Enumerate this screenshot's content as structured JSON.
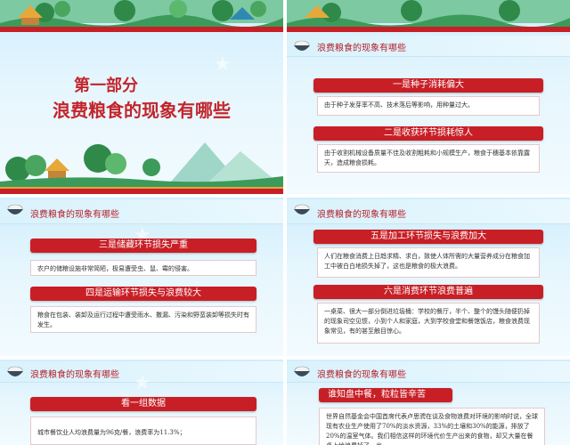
{
  "cover": {
    "part": "第一部分",
    "title": "浪费粮食的现象有哪些"
  },
  "header_title": "浪费粮食的现象有哪些",
  "slide2": {
    "bar1": "一是种子消耗偏大",
    "card1": "由于种子发芽率不高、技术落后等影响，用种量过大。",
    "bar2": "二是收获环节损耗惊人",
    "card2": "由于收割机械设备质量不佳及收割粗耗和小规模生产，粮食于穗基本依靠露天，造成粮食损耗。"
  },
  "slide3": {
    "bar1": "三是储藏环节损失严重",
    "card1": "农户的储粮设施非常简陋，极易遭受虫、鼠、霉的侵害。",
    "bar2": "四是运输环节损失与浪费较大",
    "card2": "粮食在包装、装卸及运行过程中遭受雨水、撒漏、污染和野蛮装卸等损失时有发生。"
  },
  "slide4": {
    "bar1": "五是加工环节损失与浪费加大",
    "card1": "人们在粮食消费上日趋求精、求白，致使人体所需的大量营养成分在粮食加工中被白白地损失掉了，这也是粮食的极大浪费。",
    "bar2": "六是消费环节浪费普遍",
    "card2": "一桌菜、很大一部分倒进垃圾桶：学校的餐厅，半个、整个的馒头随便扔掉的现象司空见惯，小到个人和家庭，大到学校食堂和餐馆饭店，粮食浪费现象常见，有的甚至触目惊心。"
  },
  "slide5": {
    "bar1": "看一组数据",
    "card1": "城市餐饮业人均浪费量为96克/餐，浪费率为11.3%；"
  },
  "slide6": {
    "bar1": "谁知盘中餐，粒粒皆辛苦",
    "card1": "世界自然基金会中国首席代表卢思骋在谈及食物浪费对环境的影响时说，全球现有农业生产使用了70%的淡水资源，33%的土壤和30%的能源，排放了20%的温室气体。我们相信这样的环境代价生产出来的食物，却又大量在餐桌上给浪费掉了，也"
  },
  "colors": {
    "accent_red": "#c81f26",
    "title_red": "#c3252c",
    "sky": "#cfeefd"
  }
}
